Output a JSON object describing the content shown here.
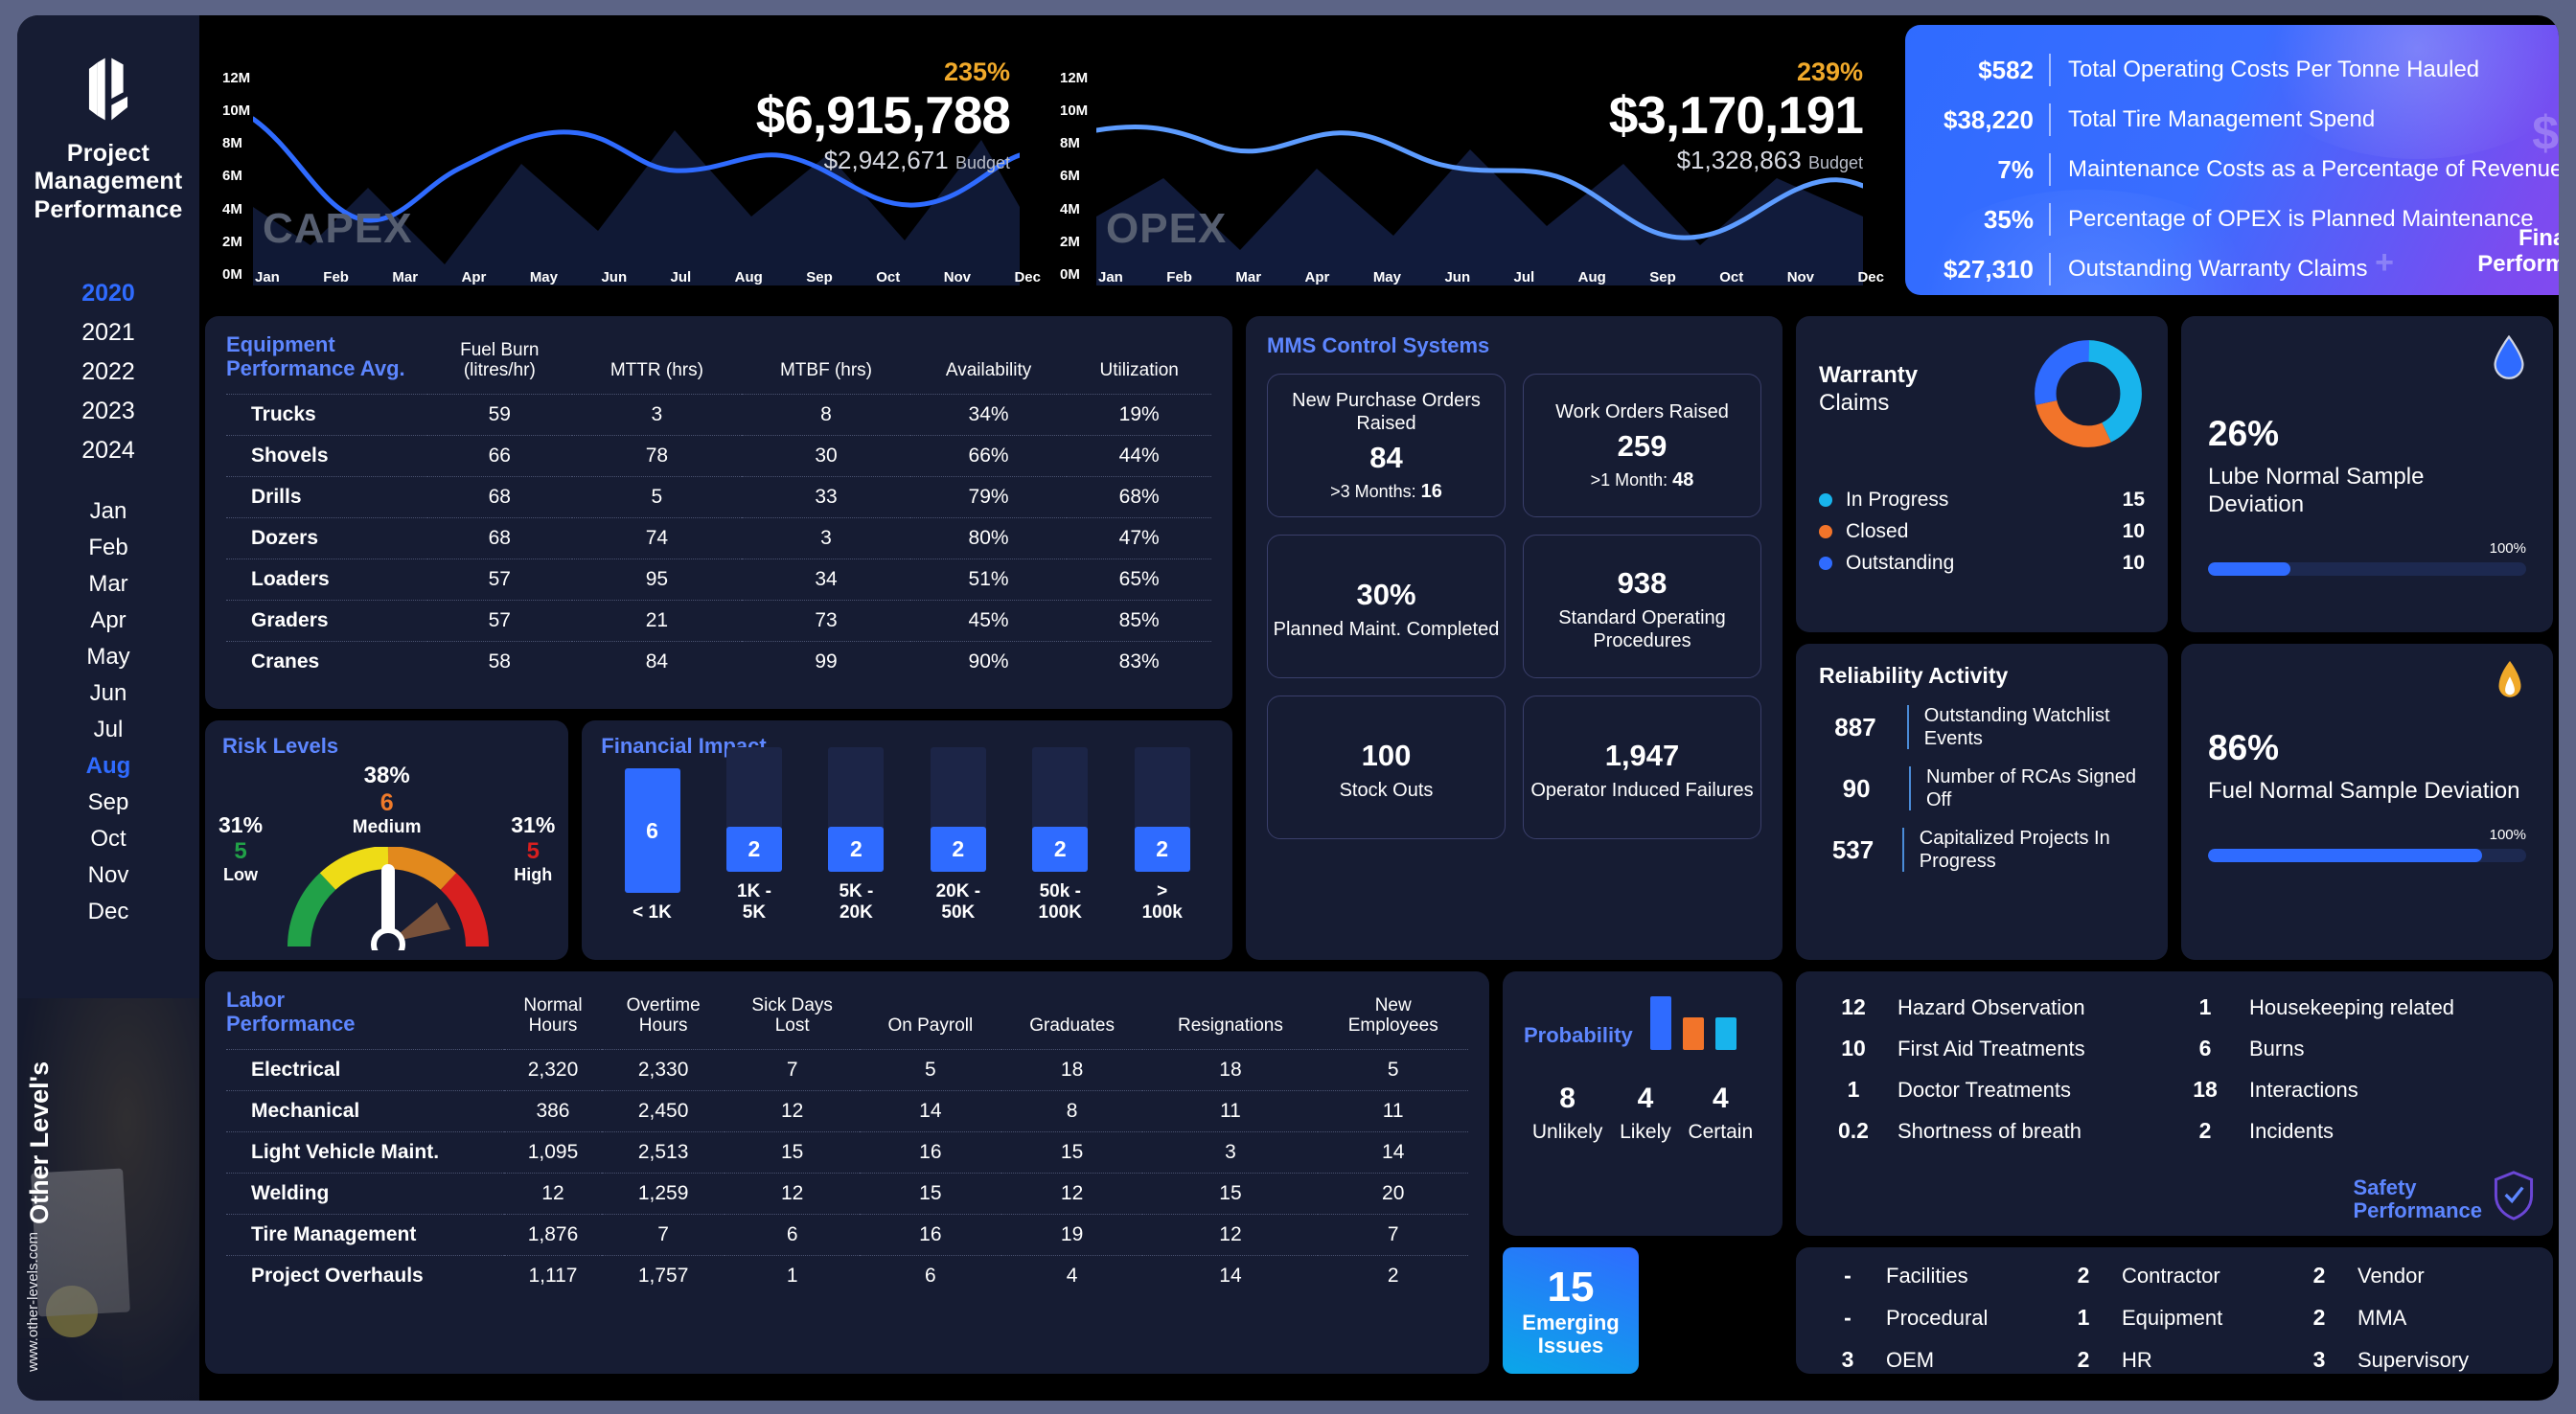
{
  "app": {
    "title": "Project Management Performance"
  },
  "sidebar": {
    "years": [
      "2020",
      "2021",
      "2022",
      "2023",
      "2024"
    ],
    "active_year": "2020",
    "months": [
      "Jan",
      "Feb",
      "Mar",
      "Apr",
      "May",
      "Jun",
      "Jul",
      "Aug",
      "Sep",
      "Oct",
      "Nov",
      "Dec"
    ],
    "active_month": "Aug",
    "brand": "Other Level's",
    "url": "www.other-levels.com"
  },
  "capex": {
    "label": "CAPEX",
    "percent": "235%",
    "value": "$6,915,788",
    "budget_value": "$2,942,671",
    "budget_word": "Budget",
    "y_ticks": [
      "12M",
      "10M",
      "8M",
      "6M",
      "4M",
      "2M",
      "0M"
    ],
    "months": [
      "Jan",
      "Feb",
      "Mar",
      "Apr",
      "May",
      "Jun",
      "Jul",
      "Aug",
      "Sep",
      "Oct",
      "Nov",
      "Dec"
    ]
  },
  "opex": {
    "label": "OPEX",
    "percent": "239%",
    "value": "$3,170,191",
    "budget_value": "$1,328,863",
    "budget_word": "Budget",
    "y_ticks": [
      "12M",
      "10M",
      "8M",
      "6M",
      "4M",
      "2M",
      "0M"
    ],
    "months": [
      "Jan",
      "Feb",
      "Mar",
      "Apr",
      "May",
      "Jun",
      "Jul",
      "Aug",
      "Sep",
      "Oct",
      "Nov",
      "Dec"
    ]
  },
  "financial_performance": {
    "title_line1": "Financial",
    "title_line2": "Performance",
    "rows": [
      {
        "value": "$582",
        "label": "Total Operating Costs Per Tonne Hauled"
      },
      {
        "value": "$38,220",
        "label": "Total Tire Management Spend"
      },
      {
        "value": "7%",
        "label": "Maintenance Costs as a Percentage of Revenue"
      },
      {
        "value": "35%",
        "label": "Percentage of OPEX is Planned Maintenance"
      },
      {
        "value": "$27,310",
        "label": "Outstanding Warranty Claims"
      }
    ]
  },
  "equipment": {
    "title_accent": "Equipment Performance",
    "title_muted": " Avg.",
    "columns": [
      "Fuel Burn (litres/hr)",
      "MTTR (hrs)",
      "MTBF (hrs)",
      "Availability",
      "Utilization"
    ],
    "columns_lines": [
      [
        "Fuel Burn",
        "(litres/hr)"
      ],
      [
        "MTTR (hrs)"
      ],
      [
        "MTBF (hrs)"
      ],
      [
        "Availability"
      ],
      [
        "Utilization"
      ]
    ],
    "rows": [
      {
        "name": "Trucks",
        "cells": [
          "59",
          "3",
          "8",
          "34%",
          "19%"
        ]
      },
      {
        "name": "Shovels",
        "cells": [
          "66",
          "78",
          "30",
          "66%",
          "44%"
        ]
      },
      {
        "name": "Drills",
        "cells": [
          "68",
          "5",
          "33",
          "79%",
          "68%"
        ]
      },
      {
        "name": "Dozers",
        "cells": [
          "68",
          "74",
          "3",
          "80%",
          "47%"
        ]
      },
      {
        "name": "Loaders",
        "cells": [
          "57",
          "95",
          "34",
          "51%",
          "65%"
        ]
      },
      {
        "name": "Graders",
        "cells": [
          "57",
          "21",
          "73",
          "45%",
          "85%"
        ]
      },
      {
        "name": "Cranes",
        "cells": [
          "58",
          "84",
          "99",
          "90%",
          "83%"
        ]
      }
    ]
  },
  "mms": {
    "title": "MMS Control Systems",
    "boxes": [
      {
        "label": "New Purchase Orders Raised",
        "number": "84",
        "sub_prefix": ">3 Months: ",
        "sub_value": "16",
        "order": "label-first"
      },
      {
        "label": "Work Orders Raised",
        "number": "259",
        "sub_prefix": ">1 Month: ",
        "sub_value": "48",
        "order": "label-first"
      },
      {
        "label": "Planned Maint. Completed",
        "number": "30%",
        "sub_prefix": "",
        "sub_value": "",
        "order": "number-first"
      },
      {
        "label": "Standard Operating Procedures",
        "number": "938",
        "sub_prefix": "",
        "sub_value": "",
        "order": "number-first"
      },
      {
        "label": "Stock Outs",
        "number": "100",
        "sub_prefix": "",
        "sub_value": "",
        "order": "number-first"
      },
      {
        "label": "Operator Induced Failures",
        "number": "1,947",
        "sub_prefix": "",
        "sub_value": "",
        "order": "number-first"
      }
    ]
  },
  "warranty": {
    "title_bold": "Warranty",
    "title_rest": "Claims",
    "legend": [
      {
        "label": "In Progress",
        "value": "15",
        "color": "#18b4ec"
      },
      {
        "label": "Closed",
        "value": "10",
        "color": "#f2742a"
      },
      {
        "label": "Outstanding",
        "value": "10",
        "color": "#2f6bff"
      }
    ]
  },
  "lube": {
    "percent": "26%",
    "label": "Lube Normal Sample Deviation",
    "max_label": "100%",
    "fill": 26,
    "icon": "water-drop-icon"
  },
  "fuel": {
    "percent": "86%",
    "label": "Fuel Normal Sample Deviation",
    "max_label": "100%",
    "fill": 86,
    "icon": "flame-icon"
  },
  "reliability": {
    "title": "Reliability Activity",
    "rows": [
      {
        "value": "887",
        "label": "Outstanding Watchlist Events"
      },
      {
        "value": "90",
        "label": "Number of RCAs Signed Off"
      },
      {
        "value": "537",
        "label": "Capitalized Projects In Progress"
      }
    ]
  },
  "risk": {
    "title": "Risk Levels",
    "center": {
      "percent": "38%",
      "count": "6",
      "label": "Medium"
    },
    "low": {
      "percent": "31%",
      "count": "5",
      "label": "Low",
      "color": "#21a148"
    },
    "high": {
      "percent": "31%",
      "count": "5",
      "label": "High",
      "color": "#d81f1f"
    }
  },
  "labor": {
    "title_line1": "Labor",
    "title_line2": "Performance",
    "columns_lines": [
      [
        "Normal",
        "Hours"
      ],
      [
        "Overtime",
        "Hours"
      ],
      [
        "Sick Days",
        "Lost"
      ],
      [
        "On Payroll"
      ],
      [
        "Graduates"
      ],
      [
        "Resignations"
      ],
      [
        "New",
        "Employees"
      ]
    ],
    "rows": [
      {
        "name": "Electrical",
        "cells": [
          "2,320",
          "2,330",
          "7",
          "5",
          "18",
          "18",
          "5"
        ]
      },
      {
        "name": "Mechanical",
        "cells": [
          "386",
          "2,450",
          "12",
          "14",
          "8",
          "11",
          "11"
        ]
      },
      {
        "name": "Light Vehicle Maint.",
        "cells": [
          "1,095",
          "2,513",
          "15",
          "16",
          "15",
          "3",
          "14"
        ]
      },
      {
        "name": "Welding",
        "cells": [
          "12",
          "1,259",
          "12",
          "15",
          "12",
          "15",
          "20"
        ]
      },
      {
        "name": "Tire Management",
        "cells": [
          "1,876",
          "7",
          "6",
          "16",
          "19",
          "12",
          "7"
        ]
      },
      {
        "name": "Project Overhauls",
        "cells": [
          "1,117",
          "1,757",
          "1",
          "6",
          "4",
          "14",
          "2"
        ]
      }
    ]
  },
  "safety": {
    "title_line1": "Safety",
    "title_line2": "Performance",
    "left": [
      {
        "value": "12",
        "label": "Hazard Observation"
      },
      {
        "value": "10",
        "label": "First Aid Treatments"
      },
      {
        "value": "1",
        "label": "Doctor Treatments"
      },
      {
        "value": "0.2",
        "label": "Shortness of breath"
      }
    ],
    "right": [
      {
        "value": "1",
        "label": "Housekeeping related"
      },
      {
        "value": "6",
        "label": "Burns"
      },
      {
        "value": "18",
        "label": "Interactions"
      },
      {
        "value": "2",
        "label": "Incidents"
      }
    ]
  },
  "emerging": {
    "count": "15",
    "label_line1": "Emerging",
    "label_line2": "Issues",
    "items": [
      {
        "value": "-",
        "label": "Facilities"
      },
      {
        "value": "2",
        "label": "Contractor"
      },
      {
        "value": "2",
        "label": "Vendor"
      },
      {
        "value": "-",
        "label": "Procedural"
      },
      {
        "value": "1",
        "label": "Equipment"
      },
      {
        "value": "2",
        "label": "MMA"
      },
      {
        "value": "3",
        "label": "OEM"
      },
      {
        "value": "2",
        "label": "HR"
      },
      {
        "value": "3",
        "label": "Supervisory"
      }
    ]
  },
  "chart_data": [
    {
      "type": "area",
      "title": "CAPEX",
      "x": [
        "Jan",
        "Feb",
        "Mar",
        "Apr",
        "May",
        "Jun",
        "Jul",
        "Aug",
        "Sep",
        "Oct",
        "Nov",
        "Dec"
      ],
      "series": [
        {
          "name": "CAPEX",
          "values": [
            8.2,
            6.6,
            5.4,
            5.6,
            6.8,
            7.8,
            7.6,
            6.2,
            5.1,
            6.4,
            8.0,
            8.6
          ]
        }
      ],
      "ylim": [
        0,
        12
      ],
      "ylabel": "",
      "ytick_labels": [
        "0M",
        "2M",
        "4M",
        "6M",
        "8M",
        "10M",
        "12M"
      ],
      "legend": "none",
      "grid": false
    },
    {
      "type": "area",
      "title": "OPEX",
      "x": [
        "Jan",
        "Feb",
        "Mar",
        "Apr",
        "May",
        "Jun",
        "Jul",
        "Aug",
        "Sep",
        "Oct",
        "Nov",
        "Dec"
      ],
      "series": [
        {
          "name": "OPEX",
          "values": [
            8.8,
            8.2,
            7.4,
            7.8,
            8.6,
            8.2,
            7.0,
            5.6,
            4.6,
            5.2,
            6.6,
            7.6
          ]
        }
      ],
      "ylim": [
        0,
        12
      ],
      "ylabel": "",
      "ytick_labels": [
        "0M",
        "2M",
        "4M",
        "6M",
        "8M",
        "10M",
        "12M"
      ],
      "legend": "none",
      "grid": false
    },
    {
      "type": "bar",
      "title": "Financial Impact",
      "categories": [
        "< 1K",
        "1K - 5K",
        "5K - 20K",
        "20K - 50K",
        "50k - 100K",
        "> 100k"
      ],
      "values": [
        6,
        2,
        2,
        2,
        2,
        2
      ],
      "ylim": [
        0,
        6
      ],
      "xlabel": "",
      "ylabel": "",
      "grid": false
    },
    {
      "type": "pie",
      "title": "Warranty Claims",
      "labels": [
        "In Progress",
        "Closed",
        "Outstanding"
      ],
      "values": [
        15,
        10,
        10
      ],
      "colors": [
        "#18b4ec",
        "#f2742a",
        "#2f6bff"
      ],
      "legend": "bottom-left"
    },
    {
      "type": "bar",
      "title": "Probability",
      "categories": [
        "Unlikely",
        "Likely",
        "Certain"
      ],
      "values": [
        8,
        4,
        4
      ],
      "colors": [
        "#2f6bff",
        "#f2742a",
        "#18b4ec"
      ],
      "ylim": [
        0,
        8
      ],
      "grid": false
    },
    {
      "type": "gauge",
      "title": "Risk Levels",
      "categories": [
        "Low",
        "Medium",
        "High"
      ],
      "values": [
        5,
        6,
        5
      ],
      "percents": [
        "31%",
        "38%",
        "31%"
      ],
      "colors": [
        "#21a148",
        "#e2a21d",
        "#d81f1f"
      ],
      "needle": 38
    }
  ]
}
